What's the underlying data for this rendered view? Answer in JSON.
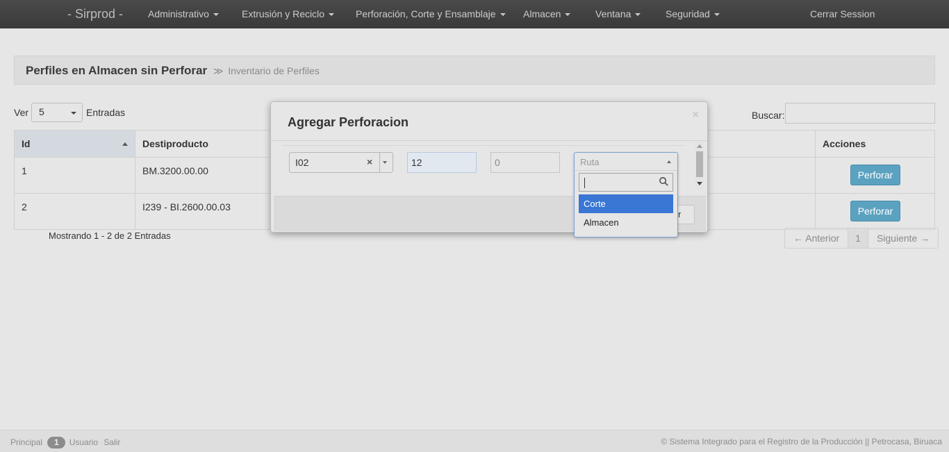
{
  "navbar": {
    "brand": "- Sirprod -",
    "items": [
      {
        "label": "Administrativo",
        "dropdown": true
      },
      {
        "label": "Extrusión y Reciclo",
        "dropdown": true
      },
      {
        "label": "Perforación, Corte y Ensamblaje",
        "dropdown": true
      },
      {
        "label": "Almacen",
        "dropdown": true
      },
      {
        "label": "Ventana",
        "dropdown": true
      },
      {
        "label": "Seguridad",
        "dropdown": true
      }
    ],
    "logout": "Cerrar Session"
  },
  "breadcrumb": {
    "title": "Perfiles en Almacen sin Perforar",
    "separator": "≫",
    "subtitle": "Inventario de Perfiles"
  },
  "table_controls": {
    "show_label": "Ver",
    "page_size": "5",
    "entries_label": "Entradas",
    "search_label": "Buscar:"
  },
  "table": {
    "columns": [
      "Id",
      "Destiproducto",
      "Acciones"
    ],
    "rows": [
      {
        "id": "1",
        "product": "BM.3200.00.00",
        "action": "Perforar"
      },
      {
        "id": "2",
        "product": "I239 - BI.2600.00.03",
        "action": "Perforar"
      }
    ]
  },
  "table_footer": {
    "info": "Mostrando 1 - 2 de 2 Entradas",
    "pager": {
      "prev": "← Anterior",
      "current": "1",
      "next": "Siguiente →"
    }
  },
  "footer": {
    "principal": "Principal",
    "badge": "1",
    "usuario": "Usuario",
    "salir": "Salir",
    "copyright": "© Sistema Integrado para el Registro de la Producción || Petrocasa, Biruaca"
  },
  "modal": {
    "title": "Agregar Perforacion",
    "close": "×",
    "code_select_value": "I02",
    "clear_symbol": "×",
    "quantity_value": "12",
    "second_value": "0",
    "footer_button_fragment": "r",
    "ruta": {
      "placeholder": "Ruta",
      "options": [
        "Corte",
        "Almacen"
      ],
      "highlighted": "Corte"
    }
  },
  "colors": {
    "navbar": "#3f3f3f",
    "perforar_button": "#5ba2c0",
    "dropdown_highlight": "#3a76d4"
  }
}
